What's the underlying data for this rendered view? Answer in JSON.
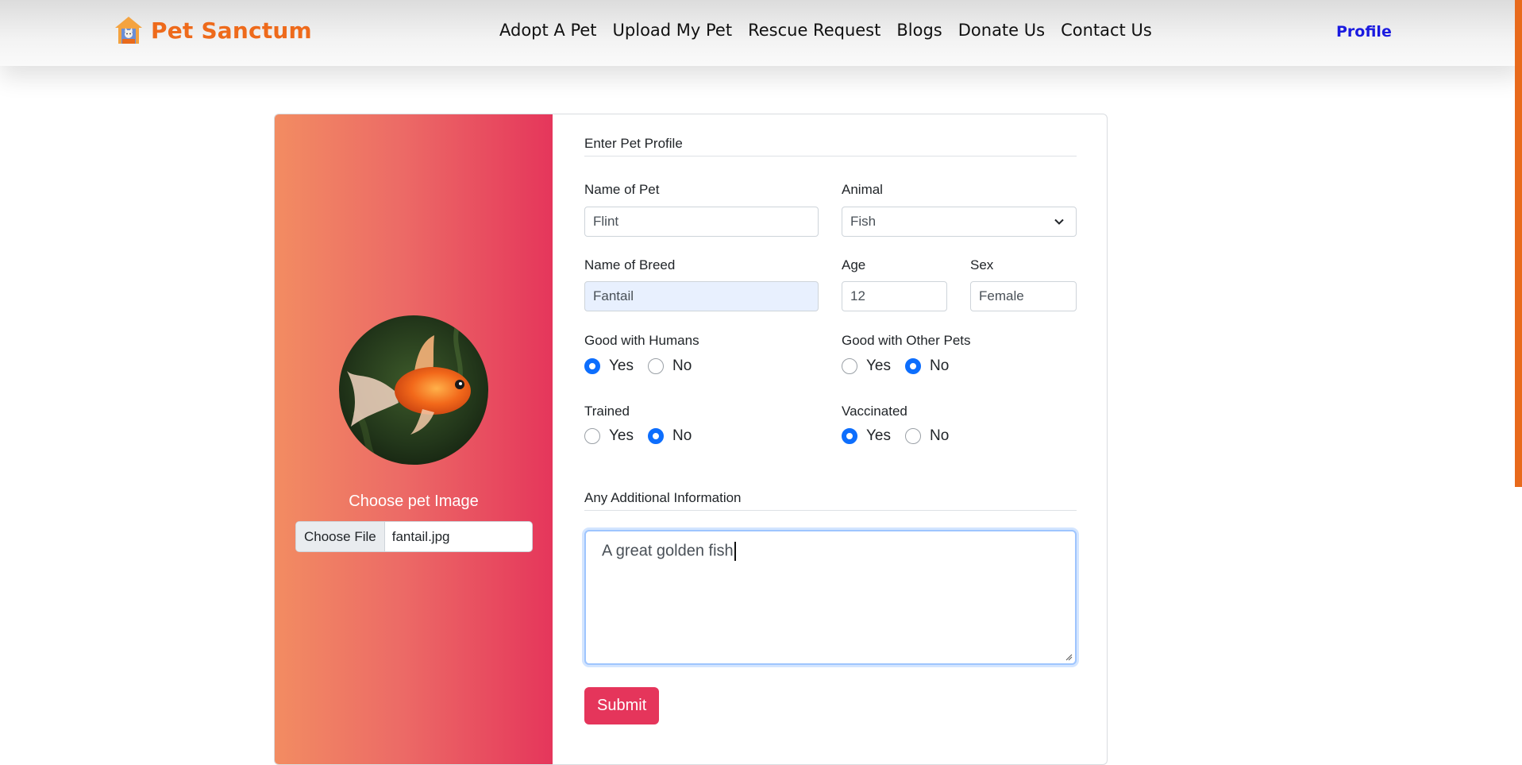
{
  "navbar": {
    "brand": "Pet Sanctum",
    "links": [
      "Adopt A Pet",
      "Upload My Pet",
      "Rescue Request",
      "Blogs",
      "Donate Us",
      "Contact Us"
    ],
    "profile": "Profile"
  },
  "image_panel": {
    "choose_label": "Choose pet Image",
    "file_button": "Choose File",
    "file_name": "fantail.jpg"
  },
  "form": {
    "section_title": "Enter Pet Profile",
    "name": {
      "label": "Name of Pet",
      "value": "Flint"
    },
    "animal": {
      "label": "Animal",
      "value": "Fish"
    },
    "breed": {
      "label": "Name of Breed",
      "value": "Fantail"
    },
    "age": {
      "label": "Age",
      "value": "12"
    },
    "sex": {
      "label": "Sex",
      "value": "Female"
    },
    "good_with_humans": {
      "label": "Good with Humans",
      "yes": "Yes",
      "no": "No",
      "selected": "Yes"
    },
    "good_with_pets": {
      "label": "Good with Other Pets",
      "yes": "Yes",
      "no": "No",
      "selected": "No"
    },
    "trained": {
      "label": "Trained",
      "yes": "Yes",
      "no": "No",
      "selected": "No"
    },
    "vaccinated": {
      "label": "Vaccinated",
      "yes": "Yes",
      "no": "No",
      "selected": "Yes"
    },
    "additional_title": "Any Additional Information",
    "additional_value": "A great golden fish",
    "submit": "Submit"
  },
  "colors": {
    "brand": "#ee6a1b",
    "accent": "#e5355b",
    "radio_checked": "#0d6efd",
    "profile_link": "#1a1ae0"
  }
}
